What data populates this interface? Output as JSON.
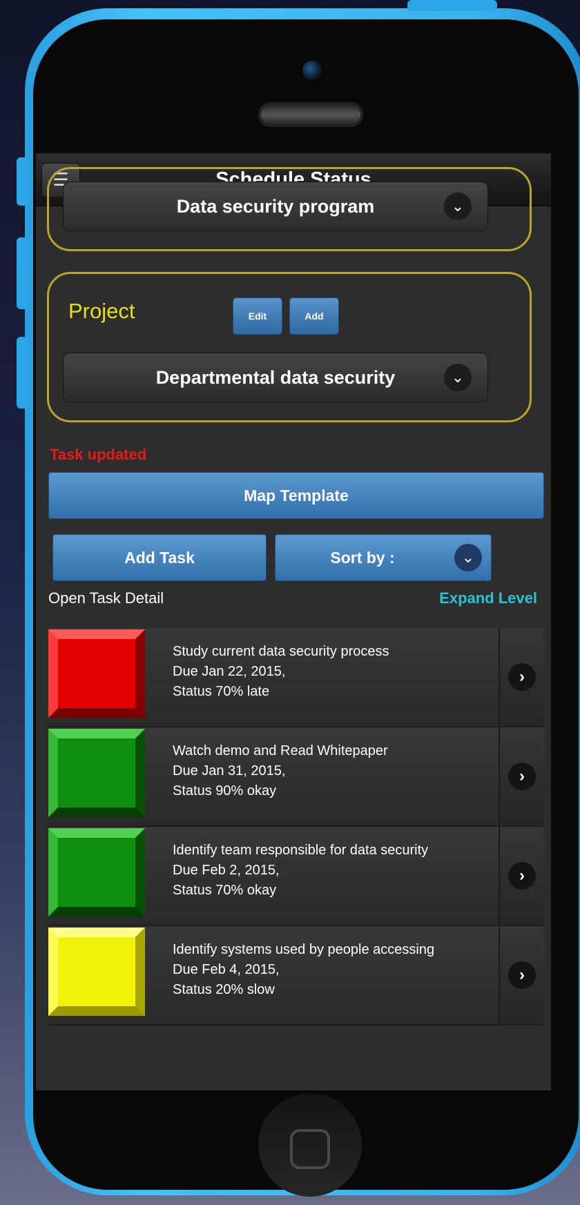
{
  "header": {
    "title": "Schedule Status",
    "menu_icon": "hamburger-icon"
  },
  "program": {
    "selected": "Data security program"
  },
  "project": {
    "label": "Project",
    "edit_label": "Edit",
    "add_label": "Add",
    "selected": "Departmental data security"
  },
  "status_message": "Task updated",
  "actions": {
    "map_template": "Map Template",
    "add_task": "Add Task",
    "sort_by": "Sort by :"
  },
  "list_header": {
    "open_detail": "Open Task Detail",
    "expand_level": "Expand Level"
  },
  "tasks": [
    {
      "title": "Study current data security process",
      "due": "Due Jan 22, 2015,",
      "status": "Status 70% late",
      "color": "#e30000"
    },
    {
      "title": "Watch demo and Read Whitepaper",
      "due": "Due Jan 31, 2015,",
      "status": "Status 90% okay",
      "color": "#0e8f0e"
    },
    {
      "title": "Identify team responsible for data security",
      "due": "Due Feb 2, 2015,",
      "status": "Status 70% okay",
      "color": "#0e8f0e"
    },
    {
      "title": "Identify systems used by people accessing",
      "due": "Due Feb 4, 2015,",
      "status": "Status 20% slow",
      "color": "#f2f20a"
    }
  ],
  "colors": {
    "accent_blue": "#3d7fbf",
    "section_border": "#b8a62a",
    "project_label": "#e6e01a",
    "status_message": "#e81a1a",
    "expand_link": "#27c4d4",
    "phone_shell": "#3bb4ee"
  }
}
